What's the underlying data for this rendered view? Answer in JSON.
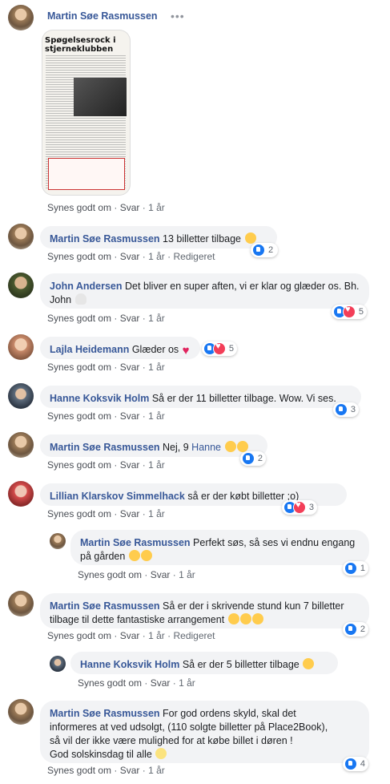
{
  "post_header": {
    "author": "Martin Søe Rasmussen",
    "menu": "•••",
    "image_caption": "Spøgelsesrock i stjerneklubben",
    "actions": {
      "like": "Synes godt om",
      "reply": "Svar",
      "time": "1 år"
    }
  },
  "comments": [
    {
      "author": "Martin Søe Rasmussen",
      "text": "13 billetter tilbage",
      "like": "Synes godt om",
      "reply": "Svar",
      "time": "1 år",
      "edited": "Redigeret",
      "reaction_count": "2"
    },
    {
      "author": "John Andersen",
      "text": "Det bliver en super aften, vi er klar og glæder os. Bh. John",
      "like": "Synes godt om",
      "reply": "Svar",
      "time": "1 år",
      "reaction_count": "5"
    },
    {
      "author": "Lajla Heidemann",
      "text": "Glæder os",
      "like": "Synes godt om",
      "reply": "Svar",
      "time": "1 år",
      "reaction_count": "5"
    },
    {
      "author": "Hanne Koksvik Holm",
      "text": "Så er der 11 billetter tilbage. Wow. Vi ses.",
      "like": "Synes godt om",
      "reply": "Svar",
      "time": "1 år",
      "reaction_count": "3"
    },
    {
      "author": "Martin Søe Rasmussen",
      "text": "Nej, 9",
      "mention": "Hanne",
      "like": "Synes godt om",
      "reply": "Svar",
      "time": "1 år",
      "reaction_count": "2"
    },
    {
      "author": "Lillian Klarskov Simmelhack",
      "text": "så er der købt billetter ;o)",
      "like": "Synes godt om",
      "reply": "Svar",
      "time": "1 år",
      "reaction_count": "3"
    },
    {
      "author": "Martin Søe Rasmussen",
      "text": "Perfekt søs, så ses vi endnu engang på gården",
      "like": "Synes godt om",
      "reply": "Svar",
      "time": "1 år",
      "reaction_count": "1"
    },
    {
      "author": "Martin Søe Rasmussen",
      "text": "Så er der i skrivende stund kun 7 billetter tilbage til dette fantastiske arrangement",
      "like": "Synes godt om",
      "reply": "Svar",
      "time": "1 år",
      "edited": "Redigeret",
      "reaction_count": "2"
    },
    {
      "author": "Hanne Koksvik Holm",
      "text": "Så er der 5 billetter tilbage",
      "like": "Synes godt om",
      "reply": "Svar",
      "time": "1 år"
    },
    {
      "author": "Martin Søe Rasmussen",
      "text_lines": [
        "For god ordens skyld, skal det",
        "informeres at ved udsolgt, (110 solgte billetter på Place2Book),",
        "så vil der ikke være mulighed for at købe billet i døren !",
        "God solskinsdag til alle"
      ],
      "like": "Synes godt om",
      "reply": "Svar",
      "time": "1 år",
      "reaction_count": "4"
    }
  ],
  "separator": "·",
  "colors": {
    "author": "#385898",
    "bubble": "#f2f3f5",
    "like": "#1877f2",
    "love": "#f33e58"
  }
}
